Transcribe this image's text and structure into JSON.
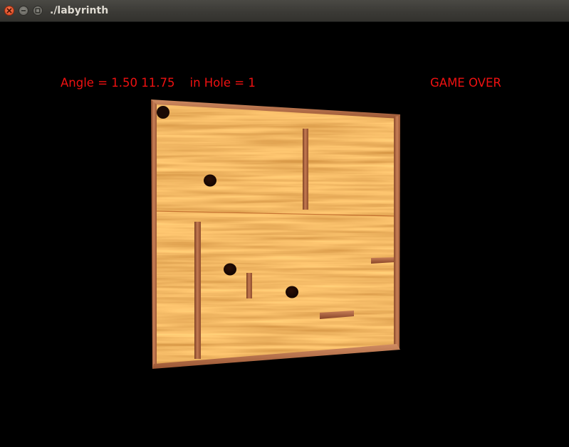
{
  "window": {
    "title": "./labyrinth",
    "buttons": [
      "close",
      "minimize",
      "maximize"
    ]
  },
  "hud": {
    "angle_text": "Angle = 1.50 11.75",
    "hole_text": "in Hole = 1",
    "status_text": "GAME OVER",
    "text_color": "#ee1111"
  },
  "game": {
    "board_material": "wood",
    "holes_count": 3,
    "ball_count": 1,
    "interior_walls_count": 5
  },
  "colors": {
    "background": "#000000",
    "wood_light": "#e08a3a",
    "wood_dark": "#b8581a",
    "frame": "#b06a42",
    "hole": "#1e0a04"
  }
}
